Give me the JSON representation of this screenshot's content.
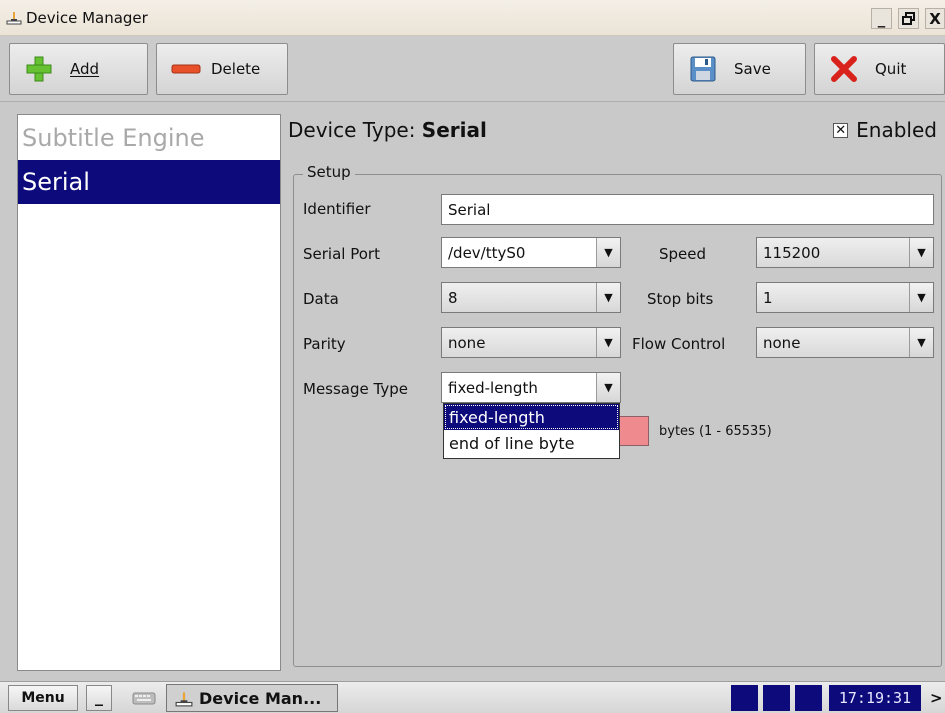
{
  "window": {
    "title": "Device Manager",
    "buttons": [
      "_",
      "❐",
      "X"
    ]
  },
  "toolbar": {
    "add_label": "Add",
    "delete_label": "Delete",
    "save_label": "Save",
    "quit_label": "Quit"
  },
  "device_list": {
    "items": [
      {
        "label": "Subtitle Engine",
        "state": "disabled"
      },
      {
        "label": "Serial",
        "state": "selected"
      }
    ]
  },
  "device": {
    "type_prefix": "Device Type:",
    "type_value": "Serial",
    "enabled_label": "Enabled",
    "enabled_checked": true
  },
  "setup": {
    "legend": "Setup",
    "identifier_label": "Identifier",
    "identifier_value": "Serial",
    "serial_port_label": "Serial Port",
    "serial_port_value": "/dev/ttyS0",
    "speed_label": "Speed",
    "speed_value": "115200",
    "data_label": "Data",
    "data_value": "8",
    "stop_bits_label": "Stop bits",
    "stop_bits_value": "1",
    "parity_label": "Parity",
    "parity_value": "none",
    "flow_control_label": "Flow Control",
    "flow_control_value": "none",
    "message_type_label": "Message Type",
    "message_type_value": "fixed-length",
    "message_type_options": [
      "fixed-length",
      "end of line byte"
    ],
    "message_type_selected_index": 0,
    "bytes_hint": "bytes (1 - 65535)"
  },
  "taskbar": {
    "menu_label": "Menu",
    "minimize_label": "_",
    "task_label": "Device Man...",
    "clock": "17:19:31",
    "more": ">"
  },
  "colors": {
    "selection": "#0d0b7b",
    "invalid_field": "#ef8a8f",
    "add_icon": "#66c233",
    "delete_icon": "#e8502a",
    "quit_icon": "#d8221b"
  }
}
